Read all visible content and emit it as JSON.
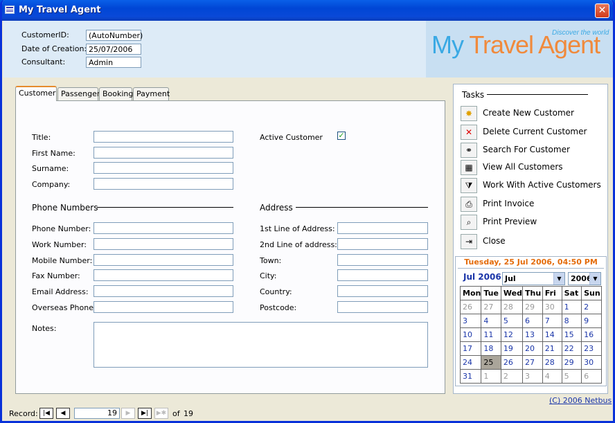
{
  "window": {
    "title": "My Travel Agent"
  },
  "header": {
    "customer_id_label": "CustomerID:",
    "customer_id_value": "(AutoNumber)",
    "date_label": "Date of Creation:",
    "date_value": "25/07/2006",
    "consultant_label": "Consultant:",
    "consultant_value": "Admin",
    "logo_part1": "My ",
    "logo_part2": "Travel Agent",
    "logo_tagline": "Discover the world"
  },
  "tabs": [
    "Customer",
    "Passenger",
    "Booking",
    "Payment"
  ],
  "form": {
    "title_label": "Title:",
    "first_name_label": "First Name:",
    "surname_label": "Surname:",
    "company_label": "Company:",
    "active_label": "Active Customer",
    "active_checked": true,
    "phone_section": "Phone Numbers",
    "address_section": "Address",
    "phone_label": "Phone Number:",
    "work_label": "Work Number:",
    "mobile_label": "Mobile Number:",
    "fax_label": "Fax Number:",
    "email_label": "Email Address:",
    "overseas_label": "Overseas Phone:",
    "addr1_label": "1st Line of Address:",
    "addr2_label": "2nd Line of address:",
    "town_label": "Town:",
    "city_label": "City:",
    "country_label": "Country:",
    "postcode_label": "Postcode:",
    "notes_label": "Notes:"
  },
  "tasks": {
    "heading": "Tasks",
    "items": [
      {
        "label": "Create New Customer",
        "icon": "create-icon"
      },
      {
        "label": "Delete Current Customer",
        "icon": "delete-icon"
      },
      {
        "label": "Search For Customer",
        "icon": "binoculars-icon"
      },
      {
        "label": "View All Customers",
        "icon": "table-icon"
      },
      {
        "label": "Work With Active Customers",
        "icon": "filter-icon"
      },
      {
        "label": "Print Invoice",
        "icon": "printer-icon"
      },
      {
        "label": "Print Preview",
        "icon": "print-preview-icon"
      },
      {
        "label": "Close",
        "icon": "close-door-icon"
      }
    ]
  },
  "calendar": {
    "now": "Tuesday, 25 Jul 2006, 04:50 PM",
    "month_title": "Jul 2006",
    "month_select": "Jul",
    "year_select": "2006",
    "weekdays": [
      "Mon",
      "Tue",
      "Wed",
      "Thu",
      "Fri",
      "Sat",
      "Sun"
    ],
    "weeks": [
      [
        "26",
        "27",
        "28",
        "29",
        "30",
        "1",
        "2"
      ],
      [
        "3",
        "4",
        "5",
        "6",
        "7",
        "8",
        "9"
      ],
      [
        "10",
        "11",
        "12",
        "13",
        "14",
        "15",
        "16"
      ],
      [
        "17",
        "18",
        "19",
        "20",
        "21",
        "22",
        "23"
      ],
      [
        "24",
        "25",
        "26",
        "27",
        "28",
        "29",
        "30"
      ],
      [
        "31",
        "1",
        "2",
        "3",
        "4",
        "5",
        "6"
      ]
    ]
  },
  "copyright": "(C) 2006 Netbus",
  "record_nav": {
    "label": "Record:",
    "current": "19",
    "of_label": "of",
    "total": "19"
  }
}
